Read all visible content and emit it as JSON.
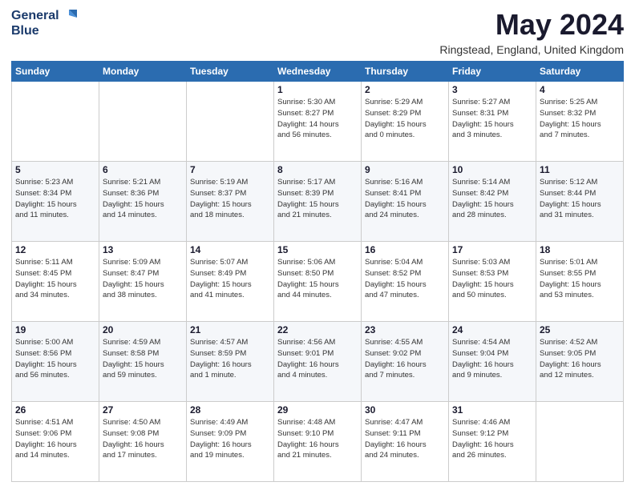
{
  "header": {
    "logo_line1": "General",
    "logo_line2": "Blue",
    "month_title": "May 2024",
    "location": "Ringstead, England, United Kingdom"
  },
  "weekdays": [
    "Sunday",
    "Monday",
    "Tuesday",
    "Wednesday",
    "Thursday",
    "Friday",
    "Saturday"
  ],
  "weeks": [
    [
      {
        "day": "",
        "info": ""
      },
      {
        "day": "",
        "info": ""
      },
      {
        "day": "",
        "info": ""
      },
      {
        "day": "1",
        "info": "Sunrise: 5:30 AM\nSunset: 8:27 PM\nDaylight: 14 hours\nand 56 minutes."
      },
      {
        "day": "2",
        "info": "Sunrise: 5:29 AM\nSunset: 8:29 PM\nDaylight: 15 hours\nand 0 minutes."
      },
      {
        "day": "3",
        "info": "Sunrise: 5:27 AM\nSunset: 8:31 PM\nDaylight: 15 hours\nand 3 minutes."
      },
      {
        "day": "4",
        "info": "Sunrise: 5:25 AM\nSunset: 8:32 PM\nDaylight: 15 hours\nand 7 minutes."
      }
    ],
    [
      {
        "day": "5",
        "info": "Sunrise: 5:23 AM\nSunset: 8:34 PM\nDaylight: 15 hours\nand 11 minutes."
      },
      {
        "day": "6",
        "info": "Sunrise: 5:21 AM\nSunset: 8:36 PM\nDaylight: 15 hours\nand 14 minutes."
      },
      {
        "day": "7",
        "info": "Sunrise: 5:19 AM\nSunset: 8:37 PM\nDaylight: 15 hours\nand 18 minutes."
      },
      {
        "day": "8",
        "info": "Sunrise: 5:17 AM\nSunset: 8:39 PM\nDaylight: 15 hours\nand 21 minutes."
      },
      {
        "day": "9",
        "info": "Sunrise: 5:16 AM\nSunset: 8:41 PM\nDaylight: 15 hours\nand 24 minutes."
      },
      {
        "day": "10",
        "info": "Sunrise: 5:14 AM\nSunset: 8:42 PM\nDaylight: 15 hours\nand 28 minutes."
      },
      {
        "day": "11",
        "info": "Sunrise: 5:12 AM\nSunset: 8:44 PM\nDaylight: 15 hours\nand 31 minutes."
      }
    ],
    [
      {
        "day": "12",
        "info": "Sunrise: 5:11 AM\nSunset: 8:45 PM\nDaylight: 15 hours\nand 34 minutes."
      },
      {
        "day": "13",
        "info": "Sunrise: 5:09 AM\nSunset: 8:47 PM\nDaylight: 15 hours\nand 38 minutes."
      },
      {
        "day": "14",
        "info": "Sunrise: 5:07 AM\nSunset: 8:49 PM\nDaylight: 15 hours\nand 41 minutes."
      },
      {
        "day": "15",
        "info": "Sunrise: 5:06 AM\nSunset: 8:50 PM\nDaylight: 15 hours\nand 44 minutes."
      },
      {
        "day": "16",
        "info": "Sunrise: 5:04 AM\nSunset: 8:52 PM\nDaylight: 15 hours\nand 47 minutes."
      },
      {
        "day": "17",
        "info": "Sunrise: 5:03 AM\nSunset: 8:53 PM\nDaylight: 15 hours\nand 50 minutes."
      },
      {
        "day": "18",
        "info": "Sunrise: 5:01 AM\nSunset: 8:55 PM\nDaylight: 15 hours\nand 53 minutes."
      }
    ],
    [
      {
        "day": "19",
        "info": "Sunrise: 5:00 AM\nSunset: 8:56 PM\nDaylight: 15 hours\nand 56 minutes."
      },
      {
        "day": "20",
        "info": "Sunrise: 4:59 AM\nSunset: 8:58 PM\nDaylight: 15 hours\nand 59 minutes."
      },
      {
        "day": "21",
        "info": "Sunrise: 4:57 AM\nSunset: 8:59 PM\nDaylight: 16 hours\nand 1 minute."
      },
      {
        "day": "22",
        "info": "Sunrise: 4:56 AM\nSunset: 9:01 PM\nDaylight: 16 hours\nand 4 minutes."
      },
      {
        "day": "23",
        "info": "Sunrise: 4:55 AM\nSunset: 9:02 PM\nDaylight: 16 hours\nand 7 minutes."
      },
      {
        "day": "24",
        "info": "Sunrise: 4:54 AM\nSunset: 9:04 PM\nDaylight: 16 hours\nand 9 minutes."
      },
      {
        "day": "25",
        "info": "Sunrise: 4:52 AM\nSunset: 9:05 PM\nDaylight: 16 hours\nand 12 minutes."
      }
    ],
    [
      {
        "day": "26",
        "info": "Sunrise: 4:51 AM\nSunset: 9:06 PM\nDaylight: 16 hours\nand 14 minutes."
      },
      {
        "day": "27",
        "info": "Sunrise: 4:50 AM\nSunset: 9:08 PM\nDaylight: 16 hours\nand 17 minutes."
      },
      {
        "day": "28",
        "info": "Sunrise: 4:49 AM\nSunset: 9:09 PM\nDaylight: 16 hours\nand 19 minutes."
      },
      {
        "day": "29",
        "info": "Sunrise: 4:48 AM\nSunset: 9:10 PM\nDaylight: 16 hours\nand 21 minutes."
      },
      {
        "day": "30",
        "info": "Sunrise: 4:47 AM\nSunset: 9:11 PM\nDaylight: 16 hours\nand 24 minutes."
      },
      {
        "day": "31",
        "info": "Sunrise: 4:46 AM\nSunset: 9:12 PM\nDaylight: 16 hours\nand 26 minutes."
      },
      {
        "day": "",
        "info": ""
      }
    ]
  ]
}
